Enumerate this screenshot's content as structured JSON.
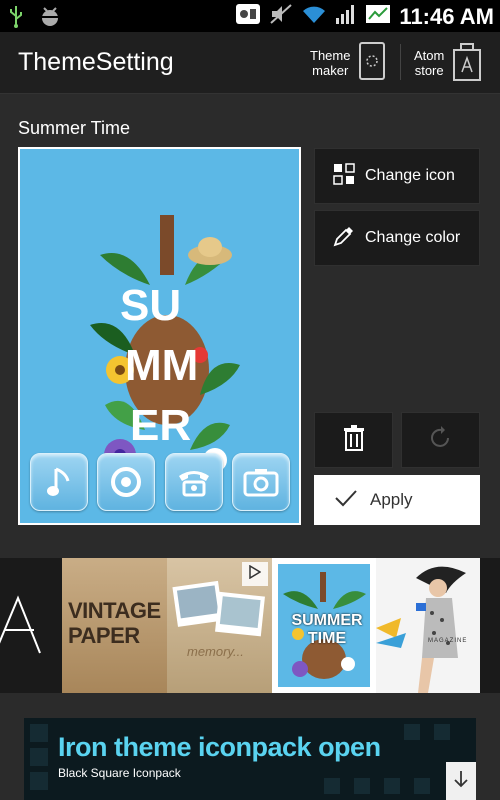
{
  "status_bar": {
    "time": "11:46 AM",
    "icons": [
      "usb-icon",
      "android-debug-icon",
      "notification-icon",
      "mute-icon",
      "wifi-icon",
      "signal-icon",
      "battery-icon"
    ]
  },
  "header": {
    "title": "ThemeSetting",
    "theme_maker_line1": "Theme",
    "theme_maker_line2": "maker",
    "atom_store_line1": "Atom",
    "atom_store_line2": "store"
  },
  "theme": {
    "name": "Summer Time",
    "preview_word_1": "SU",
    "preview_word_2": "MM",
    "preview_word_3": "ER"
  },
  "actions": {
    "change_icon": "Change icon",
    "change_color": "Change color",
    "apply": "Apply"
  },
  "themes_strip": {
    "vintage_line1": "VINTAGE",
    "vintage_line2": "PAPER",
    "memory_text": "memory...",
    "summer_line1": "SUMMER",
    "summer_line2": "TIME",
    "magazine_text": "MAGAZINE"
  },
  "ad": {
    "title": "Iron theme iconpack open",
    "subtitle": "Black Square Iconpack"
  },
  "colors": {
    "preview_bg": "#5cb8e6",
    "app_bg": "#2b2b2b",
    "ad_accent": "#5ad3f0"
  }
}
